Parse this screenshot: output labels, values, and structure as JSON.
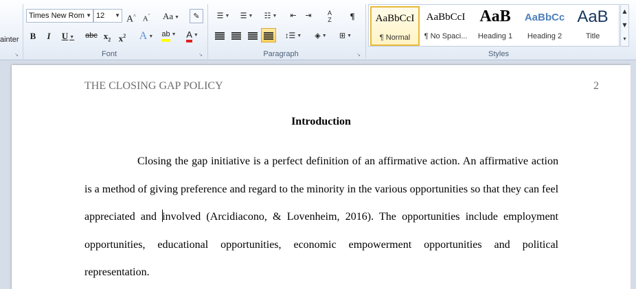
{
  "clipboard": {
    "painter_label": "ainter"
  },
  "font": {
    "group_label": "Font",
    "name": "Times New Rom",
    "size": "12",
    "grow": "A",
    "shrink": "A",
    "change_case": "Aa",
    "bold": "B",
    "italic": "I",
    "underline": "U",
    "strike": "abc",
    "subscript": "x",
    "superscript": "x",
    "effects": "A",
    "highlight": "ab",
    "font_color": "A"
  },
  "paragraph": {
    "group_label": "Paragraph",
    "pilcrow": "¶",
    "sort": "A Z"
  },
  "styles": {
    "group_label": "Styles",
    "items": [
      {
        "sample": "AaBbCcI",
        "name": "¶ Normal"
      },
      {
        "sample": "AaBbCcI",
        "name": "¶ No Spaci..."
      },
      {
        "sample": "AaB",
        "name": "Heading 1"
      },
      {
        "sample": "AaBbCc",
        "name": "Heading 2"
      },
      {
        "sample": "AaB",
        "name": "Title"
      }
    ]
  },
  "colors": {
    "accent_highlight": "#ffd35c",
    "font_color_bar": "#e02020",
    "highlight_bar": "#ffff00",
    "heading2_blue": "#4f81bd"
  },
  "document": {
    "running_head": "THE CLOSING GAP POLICY",
    "page_number": "2",
    "heading": "Introduction",
    "body_before_caret": "Closing the gap initiative is a perfect definition of an affirmative action. An affirmative action is a method of giving preference and regard to the minority in the various opportunities so that they can feel appreciated and ",
    "body_after_caret": "involved (Arcidiacono, & Lovenheim, 2016). The opportunities include employment opportunities, educational opportunities, economic empowerment opportunities and political representation."
  }
}
